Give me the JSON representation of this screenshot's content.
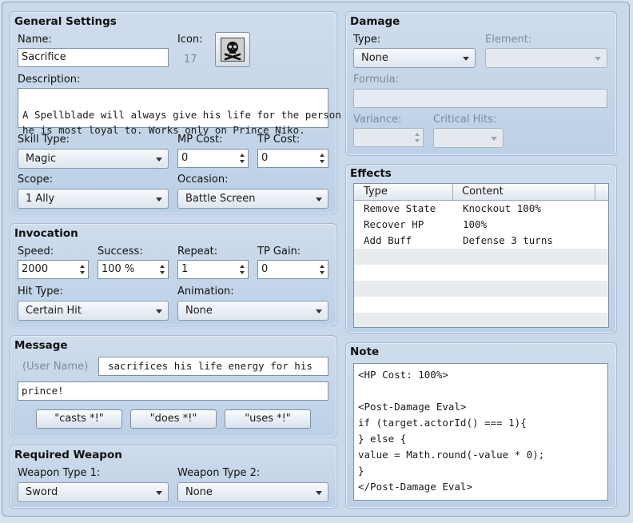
{
  "general": {
    "title": "General Settings",
    "name_label": "Name:",
    "name_value": "Sacrifice",
    "icon_label": "Icon:",
    "icon_index": "17",
    "icon_name": "skull-crossbones-icon",
    "description_label": "Description:",
    "description_line1": "A Spellblade will always give his life for the person",
    "description_line2": "he is most loyal to. Works only on Prince Niko.",
    "skill_type_label": "Skill Type:",
    "skill_type_value": "Magic",
    "mp_cost_label": "MP Cost:",
    "mp_cost_value": "0",
    "tp_cost_label": "TP Cost:",
    "tp_cost_value": "0",
    "scope_label": "Scope:",
    "scope_value": "1 Ally",
    "occasion_label": "Occasion:",
    "occasion_value": "Battle Screen"
  },
  "invocation": {
    "title": "Invocation",
    "speed_label": "Speed:",
    "speed_value": "2000",
    "success_label": "Success:",
    "success_value": "100 %",
    "repeat_label": "Repeat:",
    "repeat_value": "1",
    "tp_gain_label": "TP Gain:",
    "tp_gain_value": "0",
    "hit_type_label": "Hit Type:",
    "hit_type_value": "Certain Hit",
    "animation_label": "Animation:",
    "animation_value": "None"
  },
  "message": {
    "title": "Message",
    "user_name_placeholder": "(User Name)",
    "line1": "sacrifices his life energy for his",
    "line2": "prince!",
    "buttons": [
      "\"casts *!\"",
      "\"does *!\"",
      "\"uses *!\""
    ]
  },
  "required_weapon": {
    "title": "Required Weapon",
    "type1_label": "Weapon Type 1:",
    "type1_value": "Sword",
    "type2_label": "Weapon Type 2:",
    "type2_value": "None"
  },
  "damage": {
    "title": "Damage",
    "type_label": "Type:",
    "type_value": "None",
    "element_label": "Element:",
    "element_value": "",
    "formula_label": "Formula:",
    "formula_value": "",
    "variance_label": "Variance:",
    "variance_value": "",
    "critical_label": "Critical Hits:",
    "critical_value": ""
  },
  "effects": {
    "title": "Effects",
    "columns": [
      "Type",
      "Content"
    ],
    "rows": [
      {
        "type": "Remove State",
        "content": "Knockout 100%"
      },
      {
        "type": "Recover HP",
        "content": "100%"
      },
      {
        "type": "Add Buff",
        "content": "Defense 3 turns"
      }
    ]
  },
  "note": {
    "title": "Note",
    "text": "<HP Cost: 100%>\n\n<Post-Damage Eval>\nif (target.actorId() === 1){\n} else {\nvalue = Math.round(-value * 0);\n}\n</Post-Damage Eval>"
  }
}
